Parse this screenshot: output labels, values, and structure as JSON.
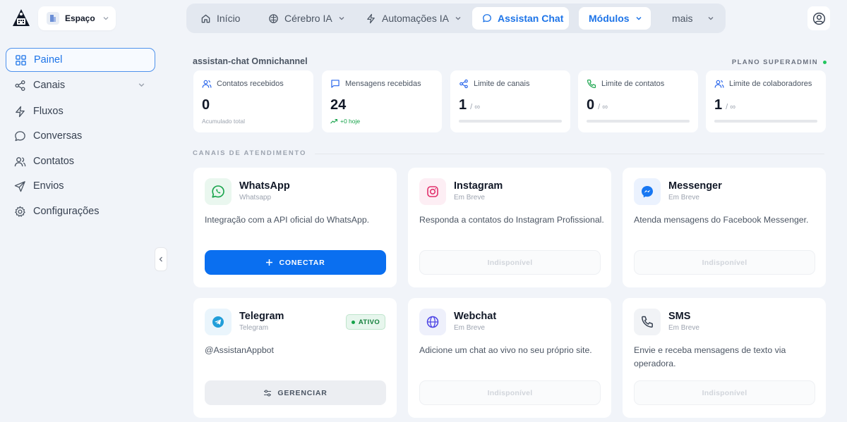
{
  "header": {
    "workspace_label": "Espaço",
    "nav": [
      {
        "label": "Início",
        "icon": "home-icon"
      },
      {
        "label": "Cérebro IA",
        "icon": "brain-icon"
      },
      {
        "label": "Automações IA",
        "icon": "bolt-icon"
      },
      {
        "label": "Assistan Chat",
        "icon": "chat-icon"
      },
      {
        "label": "Módulos"
      },
      {
        "label": "mais"
      }
    ]
  },
  "sidebar": {
    "items": [
      {
        "label": "Painel",
        "icon": "grid-icon"
      },
      {
        "label": "Canais",
        "icon": "share-icon"
      },
      {
        "label": "Fluxos",
        "icon": "bolt-icon"
      },
      {
        "label": "Conversas",
        "icon": "chat-icon"
      },
      {
        "label": "Contatos",
        "icon": "users-icon"
      },
      {
        "label": "Envios",
        "icon": "send-icon"
      },
      {
        "label": "Configurações",
        "icon": "gear-icon"
      }
    ]
  },
  "main": {
    "title": "assistan-chat Omnichannel",
    "plan": "PLANO SUPERADMIN",
    "section_title": "CANAIS DE ATENDIMENTO",
    "stats": [
      {
        "label": "Contatos recebidos",
        "value": "0",
        "sub": "Acumulado total",
        "icon": "users-icon"
      },
      {
        "label": "Mensagens recebidas",
        "value": "24",
        "sub": "+0 hoje",
        "icon": "message-icon"
      },
      {
        "label": "Limite de canais",
        "value": "1",
        "limit": "/ ∞",
        "icon": "share-icon"
      },
      {
        "label": "Limite de contatos",
        "value": "0",
        "limit": "/ ∞",
        "icon": "phone-icon"
      },
      {
        "label": "Limite de colaboradores",
        "value": "1",
        "limit": "/ ∞",
        "icon": "user-plus-icon"
      }
    ],
    "channels": [
      {
        "name": "WhatsApp",
        "sub": "Whatsapp",
        "desc": "Integração com a API oficial do WhatsApp.",
        "button": "CONECTAR",
        "icon": "whatsapp-icon",
        "color": "#16a34a"
      },
      {
        "name": "Instagram",
        "sub": "Em Breve",
        "desc": "Responda a contatos do Instagram Profissional.",
        "button": "Indisponível",
        "icon": "instagram-icon",
        "color": "#e1306c"
      },
      {
        "name": "Messenger",
        "sub": "Em Breve",
        "desc": "Atenda mensagens do Facebook Messenger.",
        "button": "Indisponível",
        "icon": "messenger-icon",
        "color": "#1877f2"
      },
      {
        "name": "Telegram",
        "sub": "Telegram",
        "desc": "@AssistanAppbot",
        "button": "GERENCIAR",
        "badge": "ATIVO",
        "icon": "telegram-icon",
        "color": "#229ed9"
      },
      {
        "name": "Webchat",
        "sub": "Em Breve",
        "desc": "Adicione um chat ao vivo no seu próprio site.",
        "button": "Indisponível",
        "icon": "globe-icon",
        "color": "#4f46e5"
      },
      {
        "name": "SMS",
        "sub": "Em Breve",
        "desc": "Envie e receba mensagens de texto via operadora.",
        "button": "Indisponível",
        "icon": "phone-icon",
        "color": "#374151"
      }
    ]
  }
}
